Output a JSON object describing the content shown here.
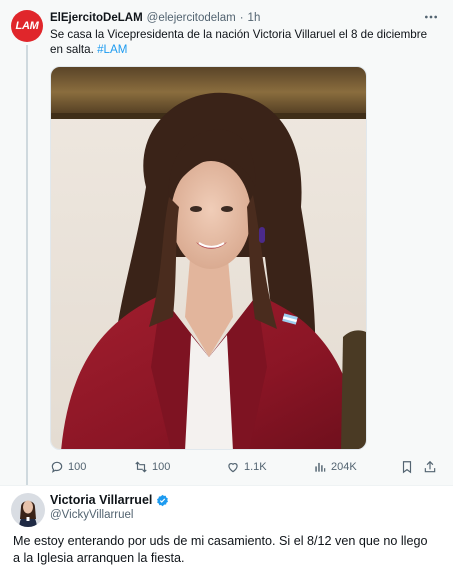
{
  "tweet1": {
    "author_name": "ElEjercitoDeLAM",
    "handle": "@elejercitodelam",
    "separator": "·",
    "time": "1h",
    "avatar_text": "LAM",
    "text": "Se casa la Vicepresidenta de la nación Victoria Villaruel el 8 de diciembre en salta.",
    "hashtag": "#LAM",
    "more_icon": "more-dots-icon",
    "actions": {
      "replies": "100",
      "retweets": "100",
      "likes": "1.1K",
      "views": "204K"
    },
    "colors": {
      "avatar_bg": "#e0262b",
      "hashtag": "#1d9bf0",
      "tweet_bg": "#f7f9f9"
    }
  },
  "tweet2": {
    "author_name": "Victoria Villarruel",
    "handle": "@VickyVillarruel",
    "verified": true,
    "text": "Me estoy enterando por uds de mi casamiento. Si el 8/12 ven que no llego a la Iglesia arranquen la fiesta.",
    "colors": {
      "verified": "#1d9bf0"
    }
  }
}
